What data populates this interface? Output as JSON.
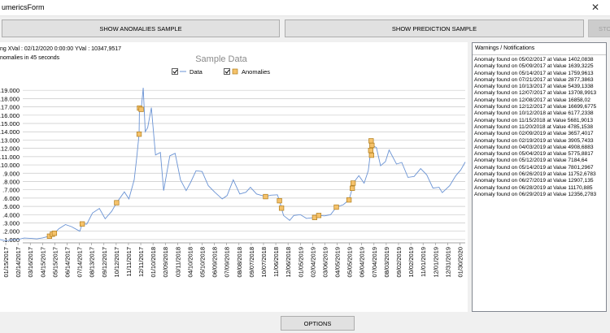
{
  "window": {
    "title": "umericsForm",
    "close_glyph": "✕"
  },
  "buttons": {
    "show_anomalies": "SHOW ANOMALIES SAMPLE",
    "show_prediction": "SHOW PREDICTION SAMPLE",
    "stop": "STO",
    "options": "OPTIONS"
  },
  "info": {
    "line1": "ng XVal : 02/12/2020 0:00:00 YVal : 10347,9517",
    "line2": "nomalies in 45 seconds"
  },
  "notifications": {
    "title": "Warnings / Notifications",
    "items": [
      "Anomaly found on 05/02/2017 at Value 1402,0838",
      "Anomaly found on 05/09/2017 at Value 1639,3225",
      "Anomaly found on 05/14/2017 at Value 1759,9613",
      "Anomaly found on 07/21/2017 at Value 2877,3863",
      "Anomaly found on 10/13/2017 at Value 5439,1338",
      "Anomaly found on 12/07/2017 at Value 13708,9913",
      "Anomaly found on 12/08/2017 at Value 16858,02",
      "Anomaly found on 12/12/2017 at Value 16699,6775",
      "Anomaly found on 10/12/2018 at Value 6177,2338",
      "Anomaly found on 11/15/2018 at Value 5681,9013",
      "Anomaly found on 11/20/2018 at Value 4785,1538",
      "Anomaly found on 02/09/2019 at Value 3657,4017",
      "Anomaly found on 02/19/2019 at Value 3905,7433",
      "Anomaly found on 04/03/2019 at Value 4908,6883",
      "Anomaly found on 05/04/2019 at Value 5775,8817",
      "Anomaly found on 05/12/2019 at Value 7184,64",
      "Anomaly found on 05/14/2019 at Value 7801,2967",
      "Anomaly found on 06/26/2019 at Value 11752,6783",
      "Anomaly found on 06/27/2019 at Value 12907,135",
      "Anomaly found on 06/28/2019 at Value 11170,885",
      "Anomaly found on 06/29/2019 at Value 12356,2783"
    ]
  },
  "chart_data": {
    "type": "line",
    "title": "Sample Data",
    "legend": [
      "Data",
      "Anomalies"
    ],
    "legend_checked": [
      true,
      true
    ],
    "legend_placement": "top-center",
    "grid": true,
    "colors": {
      "data": "#6a93d4",
      "anomaly_fill": "#f5c26b",
      "anomaly_stroke": "#b07d1c",
      "grid": "#c8c8c8"
    },
    "y_ticks": [
      1000,
      2000,
      3000,
      4000,
      5000,
      6000,
      7000,
      8000,
      9000,
      10000,
      11000,
      12000,
      13000,
      14000,
      15000,
      16000,
      17000,
      18000,
      19000
    ],
    "y_tick_labels": [
      ".1.000",
      ".2.000",
      ".3.000",
      ".4.000",
      ".5.000",
      ".6.000",
      ".7.000",
      ".8.000",
      ".9.000",
      ".10.000",
      ".11.000",
      ".12.000",
      ".13.000",
      ".14.000",
      ".15.000",
      ".16.000",
      ".17.000",
      ".18.000",
      ".19.000"
    ],
    "ylim": [
      600,
      19900
    ],
    "xlim": [
      "2017-01-01",
      "2020-02-12"
    ],
    "x_tick_labels": [
      "01/15/2017",
      "02/14/2017",
      "03/16/2017",
      "04/15/2017",
      "05/15/2017",
      "06/14/2017",
      "07/14/2017",
      "08/13/2017",
      "09/12/2017",
      "10/12/2017",
      "11/11/2017",
      "12/11/2017",
      "01/10/2018",
      "02/09/2018",
      "03/11/2018",
      "04/10/2018",
      "05/10/2018",
      "06/09/2018",
      "07/09/2018",
      "08/08/2018",
      "09/07/2018",
      "10/07/2018",
      "11/06/2018",
      "12/06/2018",
      "01/05/2019",
      "02/04/2019",
      "03/06/2019",
      "04/05/2019",
      "05/05/2019",
      "06/04/2019",
      "07/04/2019",
      "08/03/2019",
      "09/02/2019",
      "10/02/2019",
      "11/01/2019",
      "12/01/2019",
      "12/31/2019",
      "01/30/2020"
    ],
    "series": [
      {
        "name": "Data",
        "points": [
          [
            "2017-01-01",
            1000
          ],
          [
            "2017-01-15",
            850
          ],
          [
            "2017-02-01",
            980
          ],
          [
            "2017-02-15",
            1010
          ],
          [
            "2017-03-01",
            1180
          ],
          [
            "2017-03-15",
            1150
          ],
          [
            "2017-04-01",
            1080
          ],
          [
            "2017-04-15",
            1200
          ],
          [
            "2017-05-01",
            1400
          ],
          [
            "2017-05-09",
            1640
          ],
          [
            "2017-05-14",
            1760
          ],
          [
            "2017-05-25",
            2300
          ],
          [
            "2017-06-10",
            2800
          ],
          [
            "2017-06-25",
            2550
          ],
          [
            "2017-07-15",
            2000
          ],
          [
            "2017-07-21",
            2880
          ],
          [
            "2017-08-01",
            2850
          ],
          [
            "2017-08-15",
            4200
          ],
          [
            "2017-09-01",
            4750
          ],
          [
            "2017-09-15",
            3500
          ],
          [
            "2017-10-01",
            4400
          ],
          [
            "2017-10-13",
            5440
          ],
          [
            "2017-11-01",
            6750
          ],
          [
            "2017-11-12",
            5900
          ],
          [
            "2017-11-25",
            8200
          ],
          [
            "2017-12-01",
            10800
          ],
          [
            "2017-12-07",
            13710
          ],
          [
            "2017-12-08",
            16860
          ],
          [
            "2017-12-12",
            16700
          ],
          [
            "2017-12-17",
            19300
          ],
          [
            "2017-12-22",
            14000
          ],
          [
            "2017-12-28",
            14500
          ],
          [
            "2018-01-06",
            16900
          ],
          [
            "2018-01-16",
            11200
          ],
          [
            "2018-01-28",
            11500
          ],
          [
            "2018-02-05",
            6900
          ],
          [
            "2018-02-20",
            11100
          ],
          [
            "2018-03-05",
            11400
          ],
          [
            "2018-03-18",
            8200
          ],
          [
            "2018-04-01",
            6900
          ],
          [
            "2018-04-12",
            7900
          ],
          [
            "2018-04-25",
            9300
          ],
          [
            "2018-05-10",
            9200
          ],
          [
            "2018-05-25",
            7500
          ],
          [
            "2018-06-10",
            6700
          ],
          [
            "2018-06-28",
            5900
          ],
          [
            "2018-07-10",
            6300
          ],
          [
            "2018-07-25",
            8200
          ],
          [
            "2018-08-10",
            6500
          ],
          [
            "2018-08-25",
            6700
          ],
          [
            "2018-09-05",
            7300
          ],
          [
            "2018-09-20",
            6500
          ],
          [
            "2018-10-12",
            6180
          ],
          [
            "2018-10-25",
            6350
          ],
          [
            "2018-11-10",
            6400
          ],
          [
            "2018-11-15",
            5680
          ],
          [
            "2018-11-20",
            4790
          ],
          [
            "2018-11-25",
            3900
          ],
          [
            "2018-12-10",
            3300
          ],
          [
            "2018-12-20",
            3900
          ],
          [
            "2019-01-05",
            4000
          ],
          [
            "2019-01-20",
            3550
          ],
          [
            "2019-02-09",
            3660
          ],
          [
            "2019-02-19",
            3910
          ],
          [
            "2019-03-05",
            3850
          ],
          [
            "2019-03-20",
            4000
          ],
          [
            "2019-04-03",
            4910
          ],
          [
            "2019-04-20",
            5200
          ],
          [
            "2019-05-04",
            5780
          ],
          [
            "2019-05-12",
            7180
          ],
          [
            "2019-05-14",
            7800
          ],
          [
            "2019-05-28",
            8700
          ],
          [
            "2019-06-10",
            7800
          ],
          [
            "2019-06-20",
            9300
          ],
          [
            "2019-06-26",
            11750
          ],
          [
            "2019-06-27",
            12910
          ],
          [
            "2019-06-28",
            11170
          ],
          [
            "2019-06-29",
            12360
          ],
          [
            "2019-07-10",
            12100
          ],
          [
            "2019-07-20",
            9900
          ],
          [
            "2019-08-01",
            10400
          ],
          [
            "2019-08-10",
            11800
          ],
          [
            "2019-08-28",
            10100
          ],
          [
            "2019-09-10",
            10300
          ],
          [
            "2019-09-25",
            8500
          ],
          [
            "2019-10-10",
            8600
          ],
          [
            "2019-10-26",
            9550
          ],
          [
            "2019-11-10",
            8800
          ],
          [
            "2019-11-25",
            7200
          ],
          [
            "2019-12-10",
            7300
          ],
          [
            "2019-12-18",
            6650
          ],
          [
            "2020-01-05",
            7500
          ],
          [
            "2020-01-20",
            8700
          ],
          [
            "2020-02-01",
            9400
          ],
          [
            "2020-02-12",
            10350
          ]
        ]
      },
      {
        "name": "Anomalies",
        "points": [
          [
            "2017-05-02",
            1402.0838
          ],
          [
            "2017-05-09",
            1639.3225
          ],
          [
            "2017-05-14",
            1759.9613
          ],
          [
            "2017-07-21",
            2877.3863
          ],
          [
            "2017-10-13",
            5439.1338
          ],
          [
            "2017-12-07",
            13708.9913
          ],
          [
            "2017-12-08",
            16858.02
          ],
          [
            "2017-12-12",
            16699.6775
          ],
          [
            "2018-10-12",
            6177.2338
          ],
          [
            "2018-11-15",
            5681.9013
          ],
          [
            "2018-11-20",
            4785.1538
          ],
          [
            "2019-02-09",
            3657.4017
          ],
          [
            "2019-02-19",
            3905.7433
          ],
          [
            "2019-04-03",
            4908.6883
          ],
          [
            "2019-05-04",
            5775.8817
          ],
          [
            "2019-05-12",
            7184.64
          ],
          [
            "2019-05-14",
            7801.2967
          ],
          [
            "2019-06-26",
            11752.6783
          ],
          [
            "2019-06-27",
            12907.135
          ],
          [
            "2019-06-28",
            11170.885
          ],
          [
            "2019-06-29",
            12356.2783
          ]
        ]
      }
    ]
  }
}
